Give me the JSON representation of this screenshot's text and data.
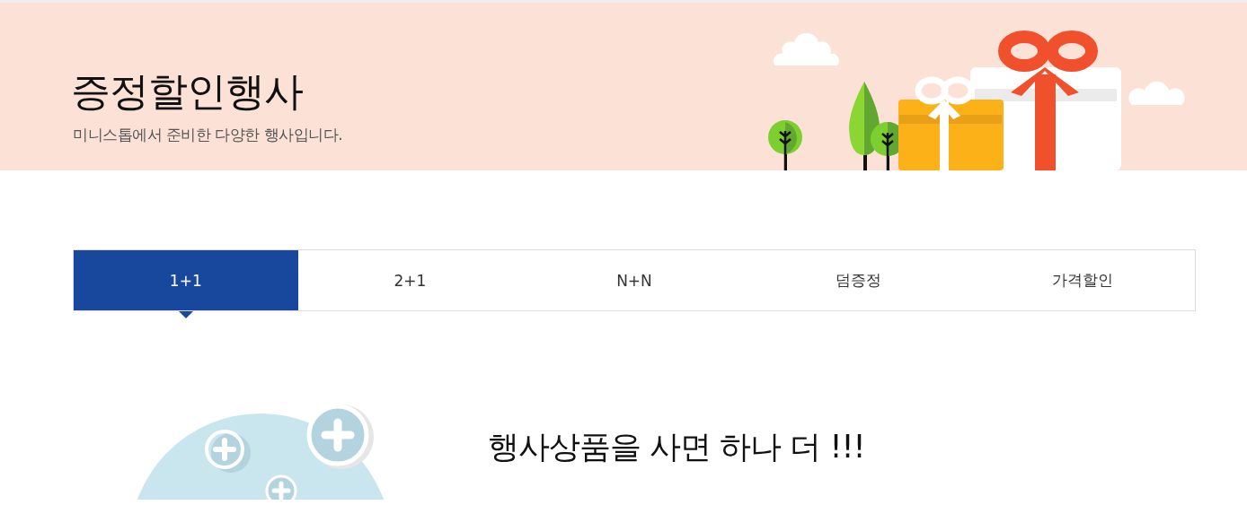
{
  "banner": {
    "title": "증정할인행사",
    "subtitle": "미니스톱에서 준비한 다양한 행사입니다."
  },
  "tabs": [
    {
      "label": "1+1",
      "selected": true
    },
    {
      "label": "2+1",
      "selected": false
    },
    {
      "label": "N+N",
      "selected": false
    },
    {
      "label": "덤증정",
      "selected": false
    },
    {
      "label": "가격할인",
      "selected": false
    }
  ],
  "section": {
    "heading": "행사상품을 사면 하나 더 !!!"
  }
}
